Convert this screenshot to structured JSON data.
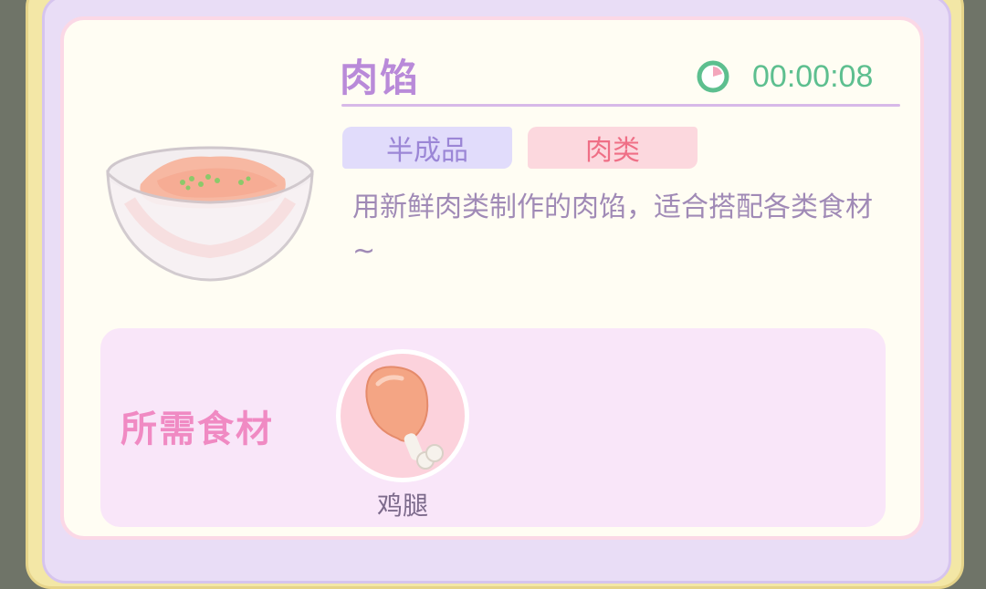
{
  "recipe": {
    "title": "肉馅",
    "timer": "00:00:08",
    "tags": [
      {
        "label": "半成品",
        "color": "#9b86d6"
      },
      {
        "label": "肉类",
        "color": "#ef6f86"
      }
    ],
    "description": "用新鲜肉类制作的肉馅，适合搭配各类食材~",
    "dish_icon": "meat-filling-bowl"
  },
  "ingredients": {
    "label": "所需食材",
    "items": [
      {
        "name": "鸡腿",
        "icon": "chicken-leg"
      }
    ]
  },
  "colors": {
    "title": "#b98ad9",
    "timer": "#5dbf8f",
    "ingredients_label": "#f08ac3"
  }
}
